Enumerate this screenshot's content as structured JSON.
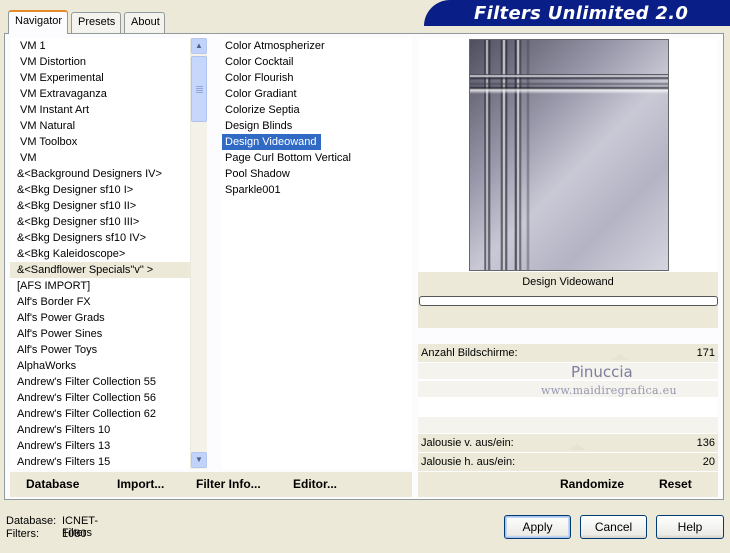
{
  "tabs": [
    {
      "label": "Navigator",
      "active": true
    },
    {
      "label": "Presets",
      "active": false
    },
    {
      "label": "About",
      "active": false
    }
  ],
  "banner": {
    "title": "Filters Unlimited 2.0"
  },
  "categories": [
    "VM 1",
    "VM Distortion",
    "VM Experimental",
    "VM Extravaganza",
    "VM Instant Art",
    "VM Natural",
    "VM Toolbox",
    "VM",
    "&<Background Designers IV>",
    "&<Bkg Designer sf10 I>",
    "&<Bkg Designer sf10 II>",
    "&<Bkg Designer sf10 III>",
    "&<Bkg Designers sf10 IV>",
    "&<Bkg Kaleidoscope>",
    "&<Sandflower Specials\"v\" >",
    "[AFS IMPORT]",
    "Alf's Border FX",
    "Alf's Power Grads",
    "Alf's Power Sines",
    "Alf's Power Toys",
    "AlphaWorks",
    "Andrew's Filter Collection 55",
    "Andrew's Filter Collection 56",
    "Andrew's Filter Collection 62",
    "Andrew's Filters 10",
    "Andrew's Filters 13",
    "Andrew's Filters 15"
  ],
  "selected_category": "&<Sandflower Specials\"v\" >",
  "filters": [
    "Color Atmospherizer",
    "Color Cocktail",
    "Color Flourish",
    "Color Gradiant",
    "Colorize Septia",
    "Design Blinds",
    "Design Videowand",
    "Page Curl Bottom Vertical",
    "Pool Shadow",
    "Sparkle001"
  ],
  "selected_filter": "Design Videowand",
  "preview": {
    "label": "Design Videowand"
  },
  "params": [
    {
      "label": "Anzahl Bildschirme:",
      "value": "171"
    },
    {
      "label": "Jalousie v. aus/ein:",
      "value": "136"
    },
    {
      "label": "Jalousie h. aus/ein:",
      "value": "20"
    }
  ],
  "watermark": {
    "title": "Pinuccia",
    "url": "www.maidiregrafica.eu"
  },
  "toolbar": {
    "database": "Database",
    "import": "Import...",
    "filter_info": "Filter Info...",
    "editor": "Editor...",
    "randomize": "Randomize",
    "reset": "Reset"
  },
  "status": {
    "database_label": "Database:",
    "database_value": "ICNET-Filters",
    "filters_label": "Filters:",
    "filters_value": "1080"
  },
  "buttons": {
    "apply": "Apply",
    "cancel": "Cancel",
    "help": "Help"
  },
  "colors": {
    "selection": "#316ac5",
    "banner": "#0a1e88",
    "face": "#ece9d8"
  }
}
